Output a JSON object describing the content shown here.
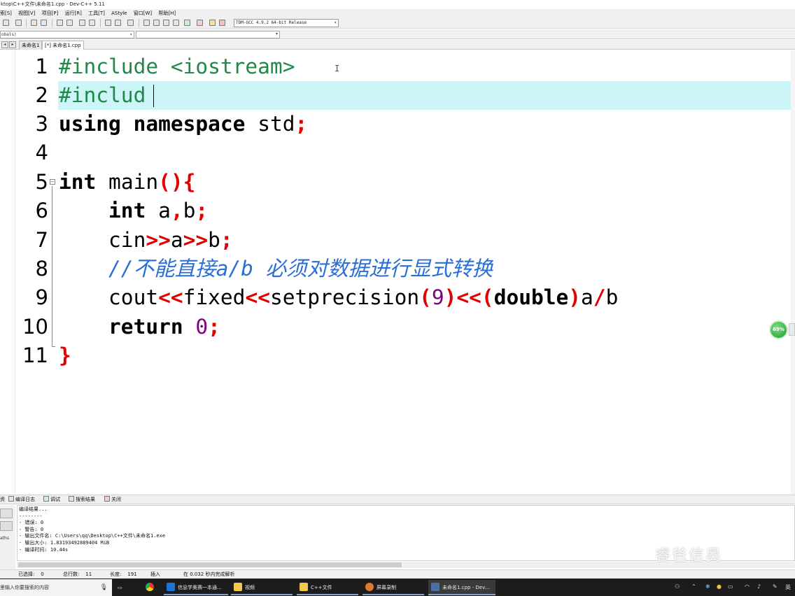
{
  "window": {
    "title": "ktop\\C++文件\\未命名1.cpp - Dev-C++ 5.11"
  },
  "menu": [
    "索[S]",
    "视图[V]",
    "项目[P]",
    "运行[R]",
    "工具[T]",
    "AStyle",
    "窗口[W]",
    "帮助[H]"
  ],
  "toolbar": {
    "compiler": "TDM-GCC 4.9.2 64-bit Release"
  },
  "classbar": {
    "scope": "obals)"
  },
  "tabs": [
    {
      "label": "未命名1"
    },
    {
      "label": "[*] 未命名1.cpp"
    }
  ],
  "editor": {
    "line_numbers": [
      "1",
      "2",
      "3",
      "4",
      "5",
      "6",
      "7",
      "8",
      "9",
      "10",
      "11"
    ],
    "code": {
      "l1_pp": "#include <iostream>",
      "l2_pp": "#includ",
      "l3_kw1": "using",
      "l3_kw2": "namespace",
      "l3_id": " std",
      "l3_semi": ";",
      "l5_kw": "int",
      "l5_id": " main",
      "l5_op": "(){",
      "l6_indent": "    ",
      "l6_kw": "int",
      "l6_a": " a",
      "l6_comma": ",",
      "l6_b": "b",
      "l6_semi": ";",
      "l7_cin": "    cin",
      "l7_op1": ">>",
      "l7_a": "a",
      "l7_op2": ">>",
      "l7_b": "b",
      "l7_semi": ";",
      "l8_comment": "    //不能直接a/b 必须对数据进行显式转换",
      "l9_cout": "    cout",
      "l9_op1": "<<",
      "l9_fixed": "fixed",
      "l9_op2": "<<",
      "l9_set": "setprecision",
      "l9_p1": "(",
      "l9_num": "9",
      "l9_p2": ")<<(",
      "l9_kw": "double",
      "l9_p3": ")",
      "l9_a": "a",
      "l9_div": "/",
      "l9_b": "b",
      "l10_indent": "    ",
      "l10_kw": "return",
      "l10_num": " 0",
      "l10_semi": ";",
      "l11_brace": "}"
    }
  },
  "badge": {
    "text": "69%"
  },
  "bottom_tabs": [
    "资",
    "编译日志",
    "调试",
    "搜索结果",
    "关闭"
  ],
  "log": {
    "side_label": "aths",
    "lines": [
      "编译结果...",
      "--------",
      "- 错误: 0",
      "- 警告: 0",
      "- 输出文件名: C:\\Users\\qq\\Desktop\\C++文件\\未命名1.exe",
      "- 输出大小: 1.83193492889404 MiB",
      "- 编译时间: 10.44s"
    ]
  },
  "status": {
    "selected_label": "已选择:",
    "selected": "0",
    "lines_label": "总行数:",
    "lines": "11",
    "length_label": "长度:",
    "length": "191",
    "mode": "插入",
    "parse": "在 0.032 秒内完成解析"
  },
  "taskbar": {
    "search_placeholder": "里输入你要搜索的内容",
    "items": [
      "信息学奥赛一本通...",
      "视频",
      "C++文件",
      "屏幕录制",
      "未命名1.cpp - Dev..."
    ],
    "lang": "英"
  },
  "watermark": "睿爸信奥"
}
